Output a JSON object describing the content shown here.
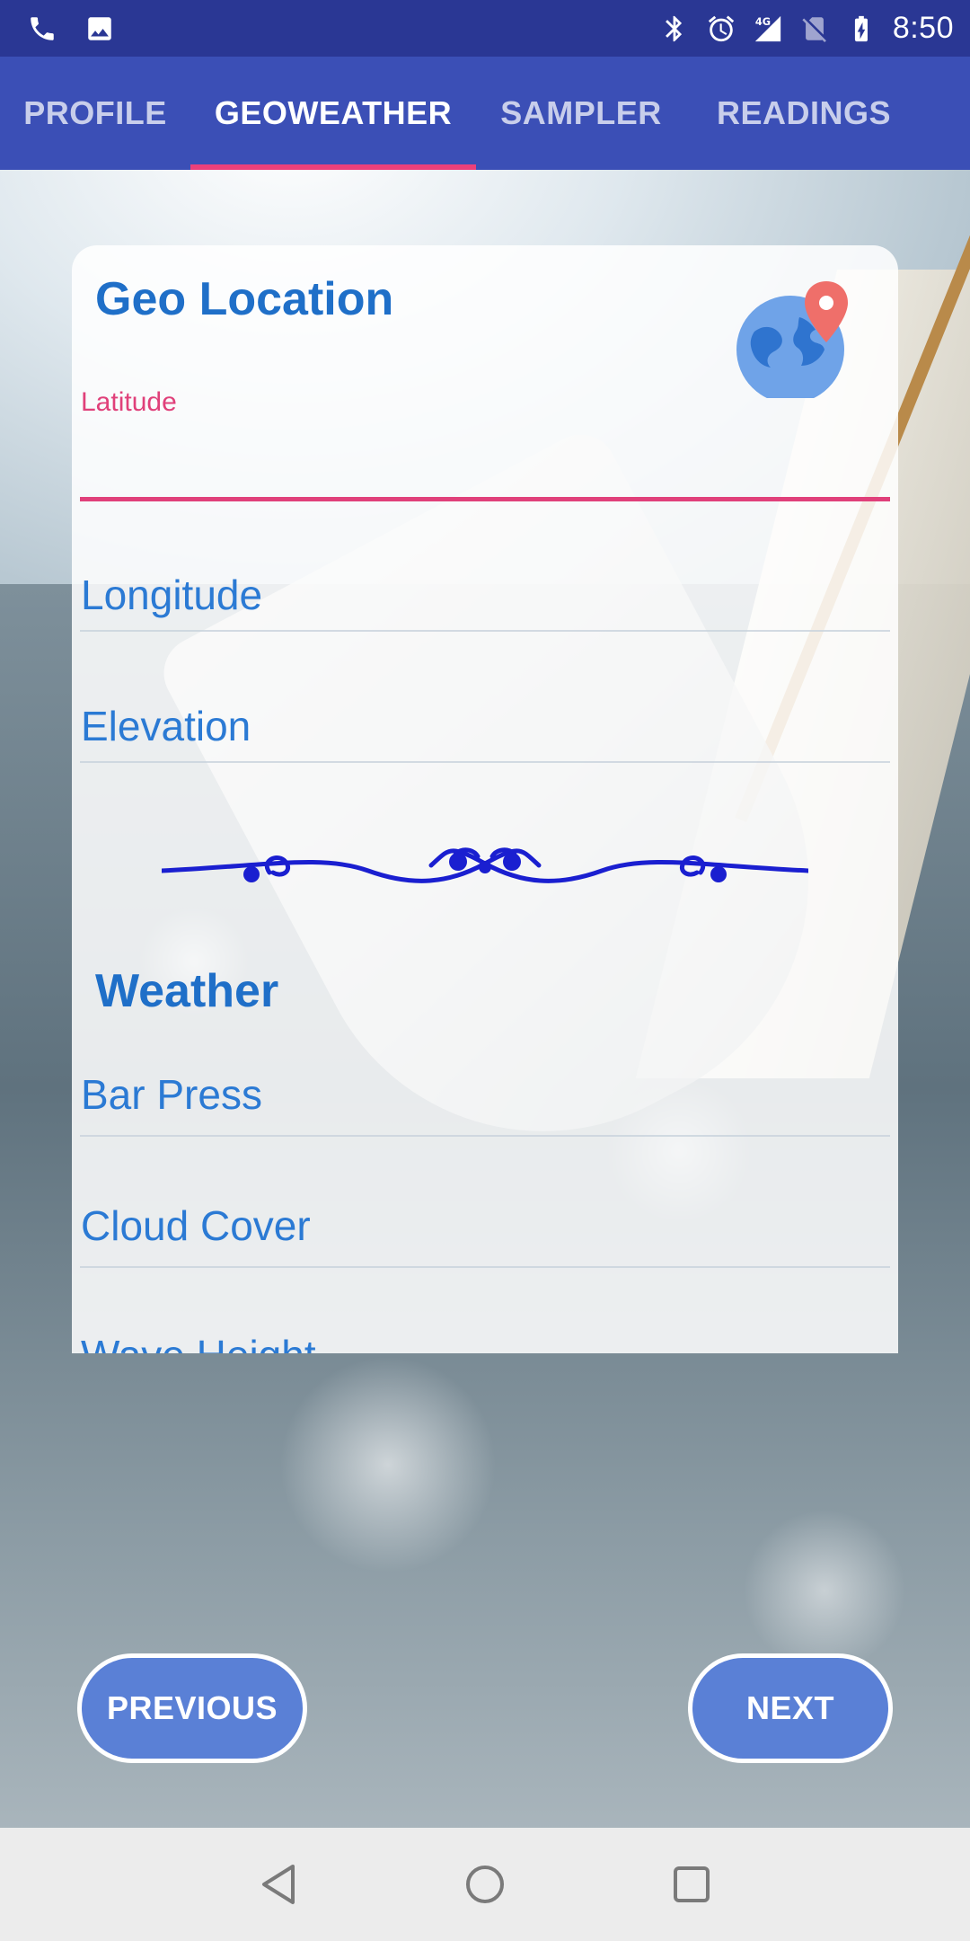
{
  "status_bar": {
    "time": "8:50",
    "left_icons": [
      "phone-icon",
      "image-icon"
    ],
    "right_icons": [
      "bluetooth-icon",
      "alarm-icon",
      "network-4g-icon",
      "no-sim-icon",
      "battery-charging-icon"
    ],
    "network_label": "4G"
  },
  "tabs": [
    {
      "label": "PROFILE",
      "active": false
    },
    {
      "label": "GEOWEATHER",
      "active": true
    },
    {
      "label": "SAMPLER",
      "active": false
    },
    {
      "label": "READINGS",
      "active": false
    }
  ],
  "geo_section": {
    "title": "Geo Location",
    "icon": "globe-map-pin-icon",
    "latitude": {
      "label": "Latitude",
      "value": ""
    },
    "longitude_placeholder": "Longitude",
    "elevation_placeholder": "Elevation"
  },
  "weather_section": {
    "title": "Weather",
    "bar_press_placeholder": "Bar Press",
    "cloud_cover_placeholder": "Cloud Cover",
    "wave_height_placeholder": "Wave Height"
  },
  "buttons": {
    "previous": "PREVIOUS",
    "next": "NEXT"
  },
  "colors": {
    "status_bar": "#2a3794",
    "tab_bar": "#3b4fb6",
    "tab_indicator": "#ec407a",
    "accent_pink": "#e0407a",
    "field_text": "#2b7ad4",
    "title_blue": "#1f6fc8",
    "button_blue": "#5a80d6",
    "ornament": "#1a1fd0"
  },
  "nav_bar": [
    "back-icon",
    "home-icon",
    "recents-icon"
  ]
}
